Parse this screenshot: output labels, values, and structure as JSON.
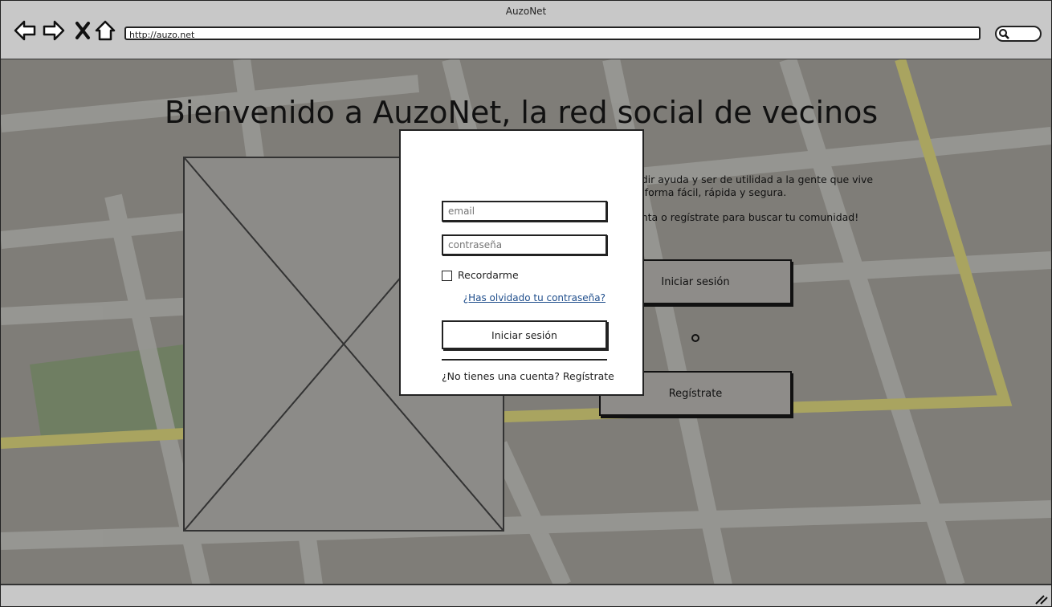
{
  "window": {
    "title": "AuzoNet"
  },
  "browser": {
    "url": "http://auzo.net",
    "back_icon": "arrow-left-icon",
    "forward_icon": "arrow-right-icon",
    "stop_icon": "close-icon",
    "home_icon": "home-icon",
    "search_icon": "search-icon"
  },
  "page": {
    "headline": "Bienvenido a AuzoNet, la red social de vecinos",
    "description": [
      "edir ayuda y ser de utilidad a la gente que vive",
      "e forma fácil, rápida y segura.",
      "enta o regístrate para buscar tu comunidad!"
    ],
    "login_button_label": "Iniciar sesión",
    "register_button_label": "Regístrate"
  },
  "login_modal": {
    "email_placeholder": "email",
    "password_placeholder": "contraseña",
    "remember_label": "Recordarme",
    "forgot_link": "¿Has olvidado tu contraseña?",
    "submit_label": "Iniciar sesión",
    "signup_text": "¿No tienes una cuenta? Regístrate"
  },
  "colors": {
    "map_background": "#7f7d78",
    "map_road": "#9a9a96",
    "map_highway": "#a9a460",
    "map_park": "#6f7e62",
    "link": "#1f4e8c"
  }
}
